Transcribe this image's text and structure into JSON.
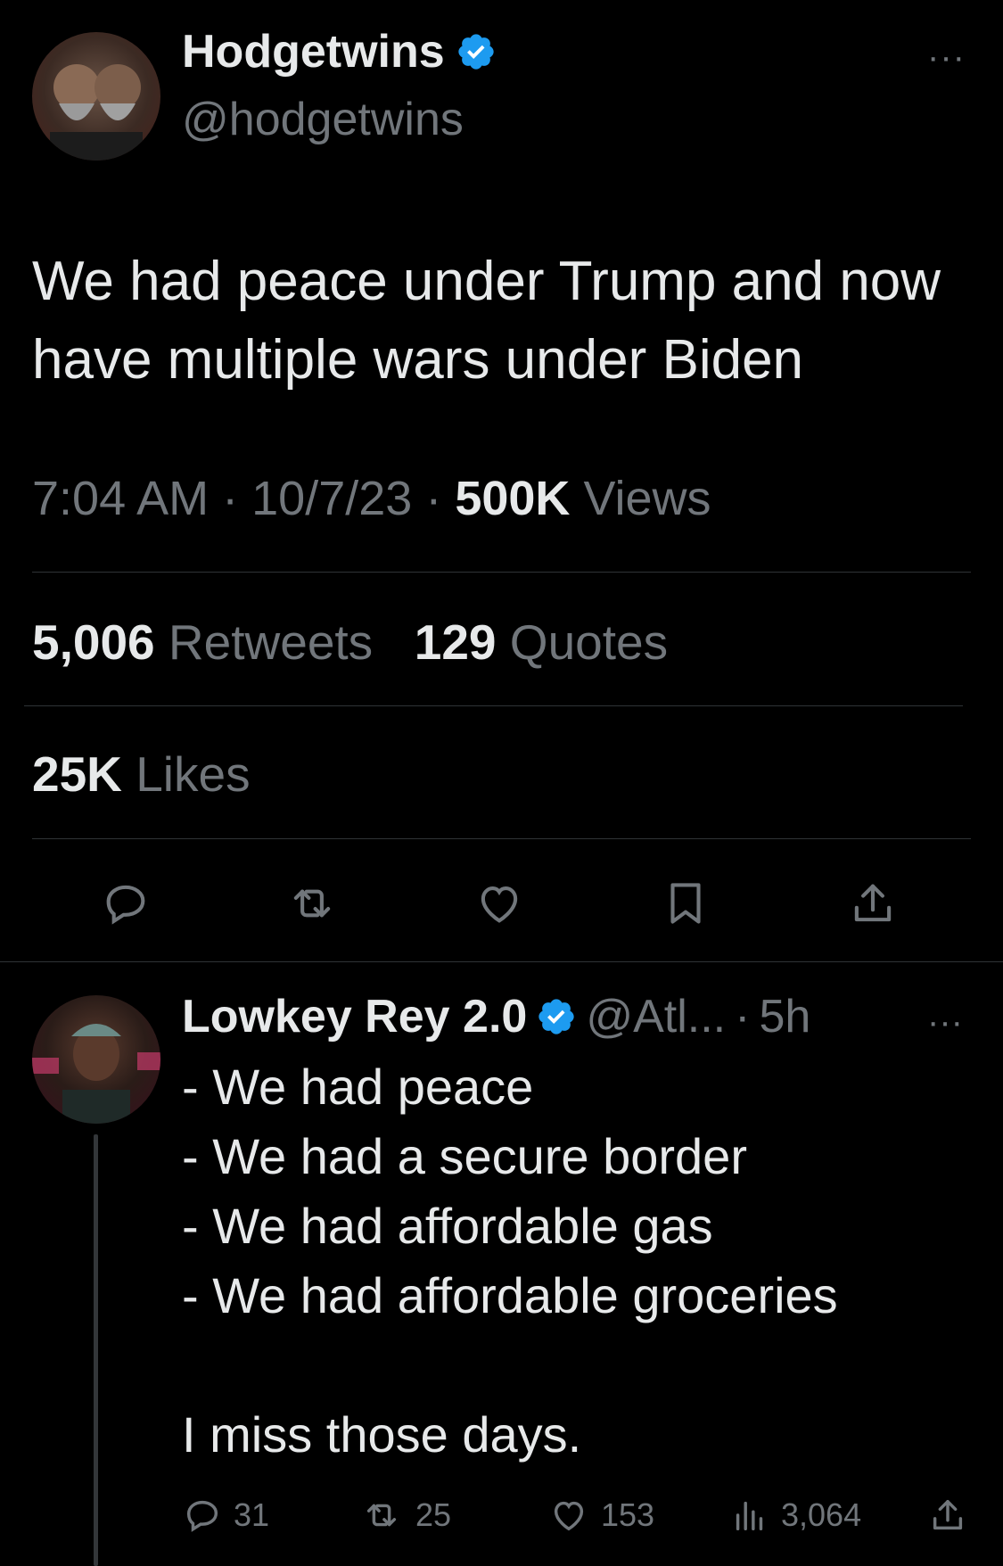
{
  "tweet": {
    "display_name": "Hodgetwins",
    "handle": "@hodgetwins",
    "text": "We had peace under Trump and now have multiple wars under Biden",
    "time": "7:04 AM",
    "date": "10/7/23",
    "views_count": "500K",
    "views_label": "Views",
    "retweets_count": "5,006",
    "retweets_label": "Retweets",
    "quotes_count": "129",
    "quotes_label": "Quotes",
    "likes_count": "25K",
    "likes_label": "Likes",
    "more": "···"
  },
  "reply": {
    "display_name": "Lowkey Rey 2.0",
    "handle": "@Atl...",
    "age": "5h",
    "text": "- We had peace\n- We had a secure border\n- We had affordable gas\n- We had affordable groceries\n\nI miss those days.",
    "replies": "31",
    "retweets": "25",
    "likes": "153",
    "views": "3,064",
    "more": "···"
  },
  "colors": {
    "background": "#000000",
    "text": "#e7e9ea",
    "secondary": "#71767b",
    "verified": "#1d9bf0",
    "divider": "#2f3336"
  },
  "icons": [
    "reply-icon",
    "retweet-icon",
    "like-icon",
    "bookmark-icon",
    "share-icon",
    "views-icon",
    "verified-badge-icon",
    "more-icon"
  ]
}
